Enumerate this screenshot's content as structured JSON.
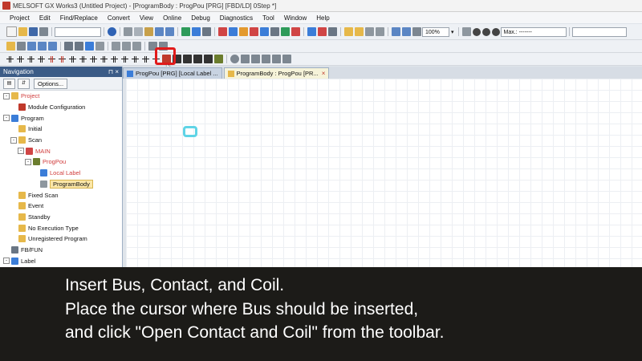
{
  "window": {
    "title": "MELSOFT GX Works3 (Untitled Project) - [ProgramBody : ProgPou [PRG] [FBD/LD] 0Step *]"
  },
  "menu": [
    "Project",
    "Edit",
    "Find/Replace",
    "Convert",
    "View",
    "Online",
    "Debug",
    "Diagnostics",
    "Tool",
    "Window",
    "Help"
  ],
  "toolbar": {
    "zoom": "100%",
    "max_label": "Max.: -------"
  },
  "navigation": {
    "title": "Navigation",
    "pin": "⊓ ×",
    "options_label": "Options...",
    "tree": [
      {
        "label": "Project",
        "indent": 0,
        "expander": "-",
        "icon": "folder-icon",
        "red": true
      },
      {
        "label": "Module Configuration",
        "indent": 1,
        "expander": "",
        "icon": "module-config-icon",
        "red": false
      },
      {
        "label": "Program",
        "indent": 0,
        "expander": "-",
        "icon": "program-icon",
        "red": false
      },
      {
        "label": "Initial",
        "indent": 1,
        "expander": "",
        "icon": "folder-icon",
        "red": false
      },
      {
        "label": "Scan",
        "indent": 1,
        "expander": "-",
        "icon": "folder-icon",
        "red": false
      },
      {
        "label": "MAIN",
        "indent": 2,
        "expander": "-",
        "icon": "program-file-icon",
        "red": true
      },
      {
        "label": "ProgPou",
        "indent": 3,
        "expander": "-",
        "icon": "pou-icon",
        "red": true
      },
      {
        "label": "Local Label",
        "indent": 4,
        "expander": "",
        "icon": "label-icon",
        "red": true
      },
      {
        "label": "ProgramBody",
        "indent": 4,
        "expander": "",
        "icon": "program-body-icon",
        "red": false,
        "selected": true
      },
      {
        "label": "Fixed Scan",
        "indent": 1,
        "expander": "",
        "icon": "folder-icon",
        "red": false
      },
      {
        "label": "Event",
        "indent": 1,
        "expander": "",
        "icon": "folder-icon",
        "red": false
      },
      {
        "label": "Standby",
        "indent": 1,
        "expander": "",
        "icon": "folder-icon",
        "red": false
      },
      {
        "label": "No Execution Type",
        "indent": 1,
        "expander": "",
        "icon": "folder-icon",
        "red": false
      },
      {
        "label": "Unregistered Program",
        "indent": 1,
        "expander": "",
        "icon": "folder-icon",
        "red": false
      },
      {
        "label": "FB/FUN",
        "indent": 0,
        "expander": "",
        "icon": "fb-icon",
        "red": false
      },
      {
        "label": "Label",
        "indent": 0,
        "expander": "-",
        "icon": "label-icon",
        "red": false
      }
    ]
  },
  "tabs": [
    {
      "label": "ProgPou [PRG] [Local Label ...",
      "active": false
    },
    {
      "label": "ProgramBody : ProgPou [PR...",
      "active": true,
      "close": "×"
    }
  ],
  "caption": {
    "line1": "Insert Bus, Contact, and Coil.",
    "line2": "Place the cursor where Bus should be inserted,",
    "line3": "and click \"Open Contact and Coil\" from the toolbar."
  },
  "colors": {
    "highlight": "#e21b1b",
    "nav_header": "#3b5b86",
    "cell_cursor": "#5fd4e6",
    "caption_bg": "#1c1b18"
  }
}
